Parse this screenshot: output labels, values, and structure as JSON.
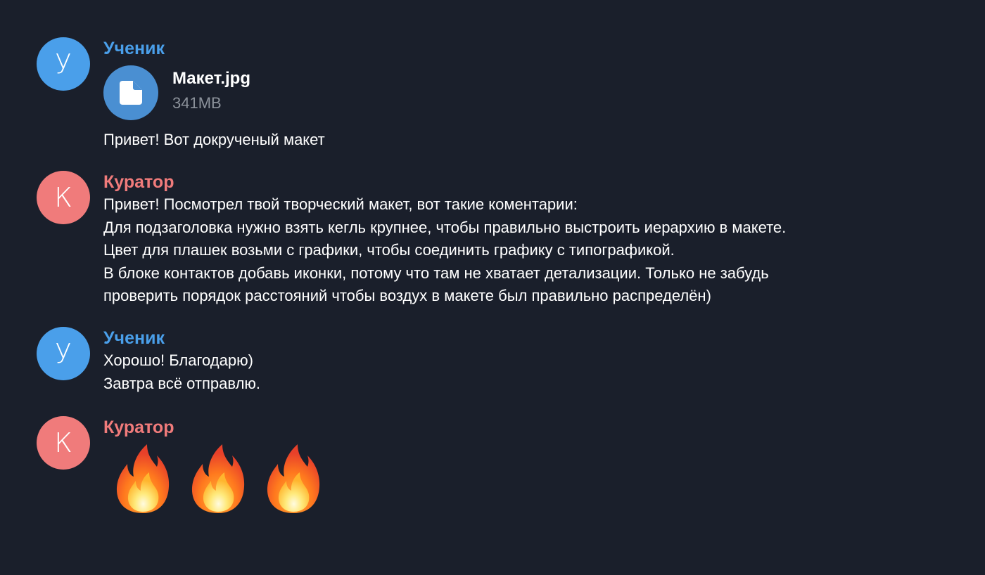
{
  "colors": {
    "background": "#1a1f2b",
    "student": "#4a9fea",
    "curator": "#f07b7b",
    "file_icon": "#4a8fd2"
  },
  "messages": [
    {
      "avatar_letter": "У",
      "sender": "Ученик",
      "file": {
        "name": "Макет.jpg",
        "size": "341MB",
        "icon": "file-icon"
      },
      "lines": [
        "Привет! Вот докрученый макет"
      ]
    },
    {
      "avatar_letter": "К",
      "sender": "Куратор",
      "lines": [
        "Привет! Посмотрел твой творческий макет, вот такие коментарии:",
        "Для подзаголовка нужно взять кегль крупнее, чтобы правильно выстроить иерархию в макете.",
        "Цвет для плашек возьми с графики, чтобы соединить графику с типографикой.",
        "В блоке контактов добавь иконки, потому что там не хватает детализации. Только не забудь",
        "проверить порядок расстояний чтобы воздух в макете был правильно распределён)"
      ]
    },
    {
      "avatar_letter": "У",
      "sender": "Ученик",
      "lines": [
        "Хорошо! Благодарю)",
        "Завтра всё отправлю."
      ]
    },
    {
      "avatar_letter": "К",
      "sender": "Куратор",
      "emoji": [
        "fire-emoji",
        "fire-emoji",
        "fire-emoji"
      ]
    }
  ]
}
